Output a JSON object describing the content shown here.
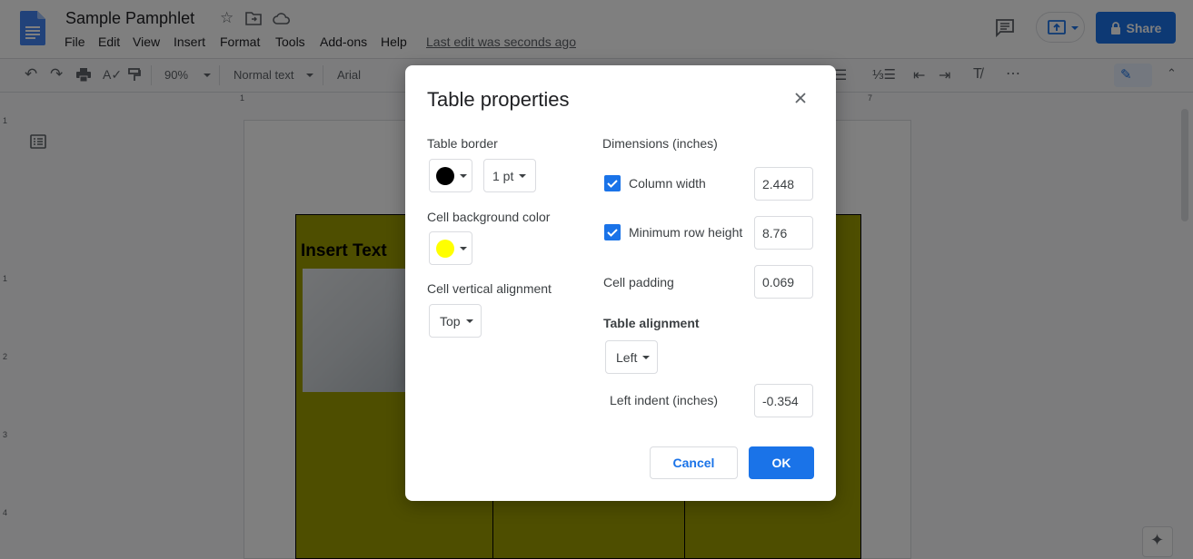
{
  "app": {
    "doc_title": "Sample Pamphlet",
    "menu": [
      "File",
      "Edit",
      "View",
      "Insert",
      "Format",
      "Tools",
      "Add-ons",
      "Help"
    ],
    "last_edit": "Last edit was seconds ago",
    "share_label": "Share"
  },
  "toolbar": {
    "zoom": "90%",
    "style": "Normal text",
    "font": "Arial"
  },
  "ruler": {
    "top_numbers": [
      "1",
      "7"
    ],
    "side_numbers": [
      "1",
      "1",
      "2",
      "3",
      "4"
    ]
  },
  "document": {
    "cell_text": "Insert Text"
  },
  "dialog": {
    "title": "Table properties",
    "table_border_label": "Table border",
    "border_color": "#000000",
    "border_width": "1 pt",
    "cell_bg_label": "Cell background color",
    "cell_bg_color": "#ffff00",
    "vertical_alignment_label": "Cell vertical alignment",
    "vertical_alignment": "Top",
    "dimensions_label": "Dimensions  (inches)",
    "column_width_label": "Column width",
    "column_width": "2.448",
    "column_width_checked": true,
    "min_row_height_label": "Minimum row height",
    "min_row_height": "8.76",
    "min_row_height_checked": true,
    "cell_padding_label": "Cell padding",
    "cell_padding": "0.069",
    "table_alignment_label": "Table alignment",
    "table_alignment": "Left",
    "left_indent_label": "Left indent  (inches)",
    "left_indent": "-0.354",
    "cancel_label": "Cancel",
    "ok_label": "OK"
  },
  "colors": {
    "accent": "#1a73e8",
    "table_fill": "#9c9c00"
  }
}
